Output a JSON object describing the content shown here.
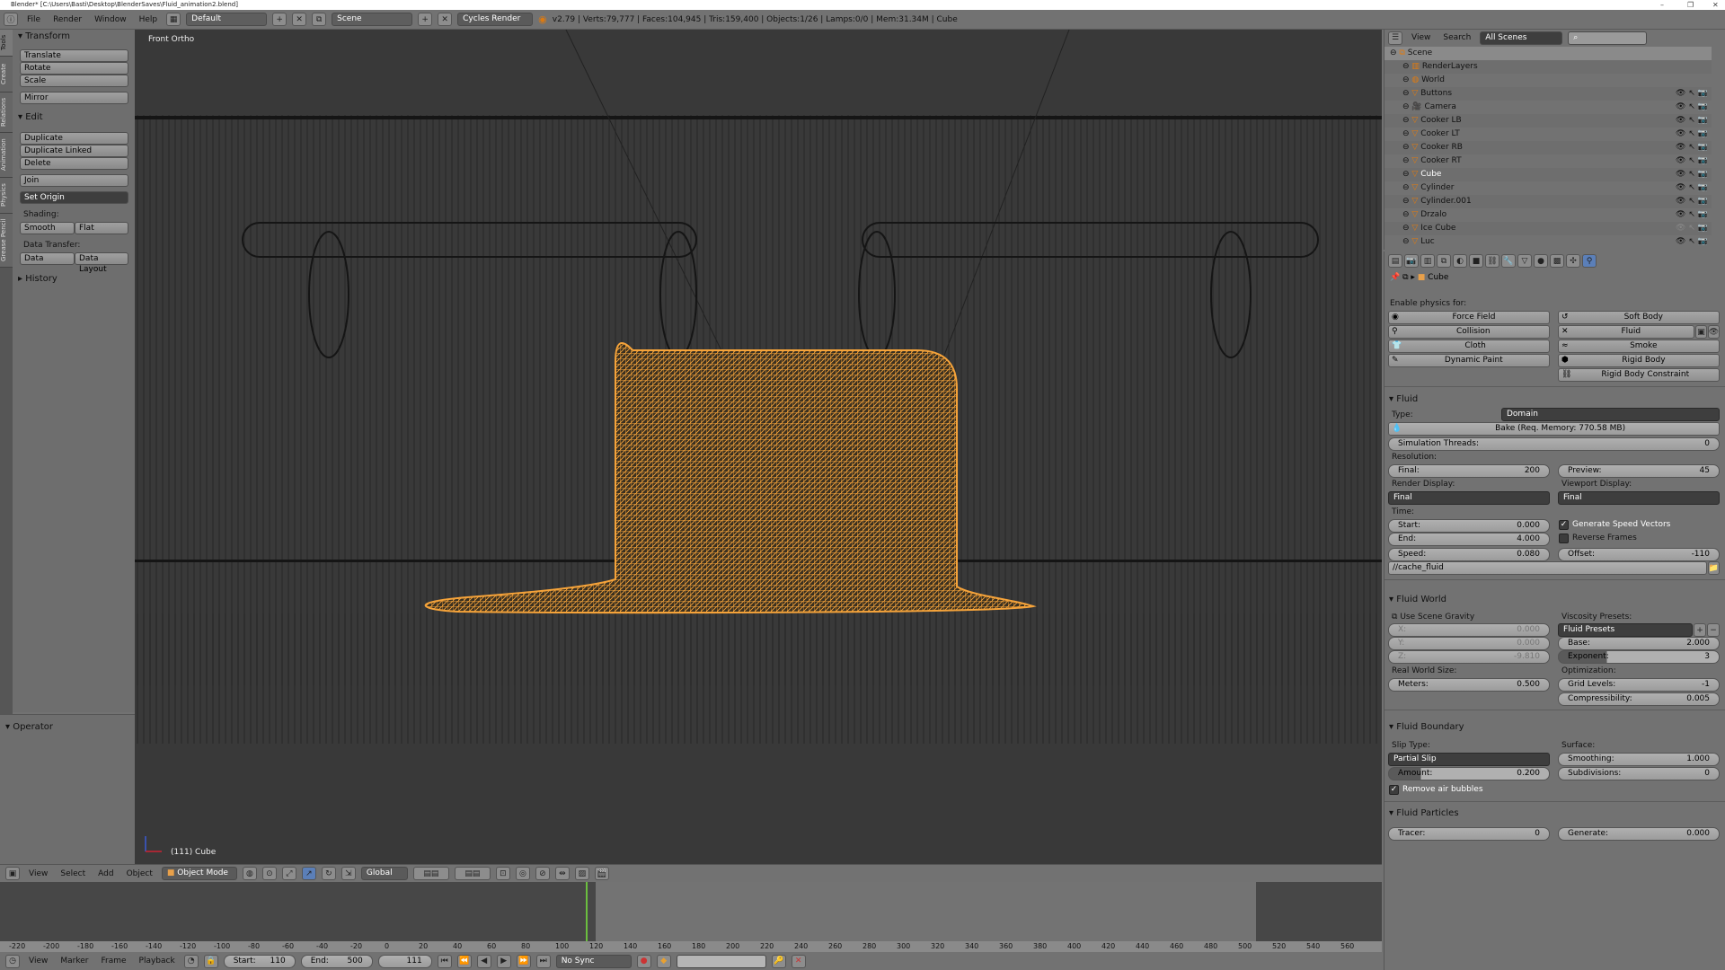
{
  "window": {
    "title": "Blender* [C:\\Users\\Basti\\Desktop\\BlenderSaves\\Fluid_animation2.blend]",
    "controls": [
      "–",
      "❐",
      "✕"
    ]
  },
  "topbar": {
    "menus": [
      "File",
      "Render",
      "Window",
      "Help"
    ],
    "layout": "Default",
    "scene": "Scene",
    "engine": "Cycles Render",
    "info": "v2.79 | Verts:79,777 | Faces:104,945 | Tris:159,400 | Objects:1/26 | Lamps:0/0 | Mem:31.34M | Cube"
  },
  "tool_tabs": [
    "Tools",
    "Create",
    "Relations",
    "Animation",
    "Physics",
    "Grease Pencil"
  ],
  "toolshelf": {
    "transform": {
      "title": "Transform",
      "buttons": [
        "Translate",
        "Rotate",
        "Scale"
      ],
      "mirror": "Mirror"
    },
    "edit": {
      "title": "Edit",
      "buttons": [
        "Duplicate",
        "Duplicate Linked",
        "Delete"
      ],
      "join": "Join",
      "set_origin": "Set Origin",
      "shading_label": "Shading:",
      "shading": [
        "Smooth",
        "Flat"
      ],
      "data_transfer_label": "Data Transfer:",
      "data_transfer": [
        "Data",
        "Data Layout"
      ]
    },
    "history": "History",
    "operator": "Operator"
  },
  "viewport": {
    "view_label": "Front Ortho",
    "object_label": "(111) Cube",
    "mesh_color": "#f5a33a"
  },
  "view_header": {
    "menus": [
      "View",
      "Select",
      "Add",
      "Object"
    ],
    "mode": "Object Mode",
    "orientation": "Global"
  },
  "timeline": {
    "ruler": [
      "-220",
      "-200",
      "-180",
      "-160",
      "-140",
      "-120",
      "-100",
      "-80",
      "-60",
      "-40",
      "-20",
      "0",
      "20",
      "40",
      "60",
      "80",
      "100",
      "120",
      "140",
      "160",
      "180",
      "200",
      "220",
      "240",
      "260",
      "280",
      "300",
      "320",
      "340",
      "360",
      "380",
      "400",
      "420",
      "440",
      "460",
      "480",
      "500",
      "520",
      "540",
      "560"
    ],
    "menus": [
      "View",
      "Marker",
      "Frame",
      "Playback"
    ],
    "start_label": "Start:",
    "start": "110",
    "end_label": "End:",
    "end": "500",
    "current": "111",
    "sync": "No Sync"
  },
  "outliner": {
    "menus": [
      "View",
      "Search"
    ],
    "filter": "All Scenes",
    "items": [
      {
        "name": "Scene",
        "level": 0
      },
      {
        "name": "RenderLayers",
        "level": 1
      },
      {
        "name": "World",
        "level": 1
      },
      {
        "name": "Buttons",
        "level": 1,
        "vis": true
      },
      {
        "name": "Camera",
        "level": 1,
        "vis": true
      },
      {
        "name": "Cooker LB",
        "level": 1,
        "vis": true
      },
      {
        "name": "Cooker LT",
        "level": 1,
        "vis": true
      },
      {
        "name": "Cooker RB",
        "level": 1,
        "vis": true
      },
      {
        "name": "Cooker RT",
        "level": 1,
        "vis": true
      },
      {
        "name": "Cube",
        "level": 1,
        "vis": true,
        "active": true
      },
      {
        "name": "Cylinder",
        "level": 1,
        "vis": true
      },
      {
        "name": "Cylinder.001",
        "level": 1,
        "vis": true
      },
      {
        "name": "Drzalo",
        "level": 1,
        "vis": true
      },
      {
        "name": "Ice Cube",
        "level": 1,
        "vis": false
      },
      {
        "name": "Luc",
        "level": 1,
        "vis": true
      }
    ]
  },
  "properties": {
    "context": "Cube",
    "enable_label": "Enable physics for:",
    "physics_left": [
      "Force Field",
      "Collision",
      "Cloth",
      "Dynamic Paint"
    ],
    "physics_right": [
      "Soft Body",
      "Fluid",
      "Smoke",
      "Rigid Body",
      "Rigid Body Constraint"
    ],
    "fluid": {
      "title": "Fluid",
      "type_label": "Type:",
      "type": "Domain",
      "bake": "Bake (Req. Memory: 770.58 MB)",
      "threads_label": "Simulation Threads:",
      "threads": "0",
      "resolution_label": "Resolution:",
      "final_label": "Final:",
      "final": "200",
      "preview_label": "Preview:",
      "preview": "45",
      "render_display_label": "Render Display:",
      "render_display": "Final",
      "viewport_display_label": "Viewport Display:",
      "viewport_display": "Final",
      "time_label": "Time:",
      "start_label": "Start:",
      "start": "0.000",
      "end_label": "End:",
      "end": "4.000",
      "speed_label": "Speed:",
      "speed": "0.080",
      "offset_label": "Offset:",
      "offset": "-110",
      "speed_vectors": "Generate Speed Vectors",
      "speed_vectors_checked": true,
      "reverse": "Reverse Frames",
      "reverse_checked": false,
      "cache_path": "//cache_fluid"
    },
    "fluid_world": {
      "title": "Fluid World",
      "use_gravity": "Use Scene Gravity",
      "x_label": "X:",
      "x": "0.000",
      "y_label": "Y:",
      "y": "0.000",
      "z_label": "Z:",
      "z": "-9.810",
      "real_world_label": "Real World Size:",
      "meters_label": "Meters:",
      "meters": "0.500",
      "viscosity_label": "Viscosity Presets:",
      "presets": "Fluid Presets",
      "base_label": "Base:",
      "base": "2.000",
      "exponent_label": "Exponent:",
      "exponent": "3",
      "optimization_label": "Optimization:",
      "grid_label": "Grid Levels:",
      "grid": "-1",
      "compress_label": "Compressibility:",
      "compress": "0.005"
    },
    "fluid_boundary": {
      "title": "Fluid Boundary",
      "slip_label": "Slip Type:",
      "slip": "Partial Slip",
      "amount_label": "Amount:",
      "amount": "0.200",
      "surface_label": "Surface:",
      "smoothing_label": "Smoothing:",
      "smoothing": "1.000",
      "subdiv_label": "Subdivisions:",
      "subdiv": "0",
      "remove_bubbles": "Remove air bubbles",
      "remove_bubbles_checked": true
    },
    "fluid_particles": {
      "title": "Fluid Particles",
      "tracer_label": "Tracer:",
      "tracer": "0",
      "generate_label": "Generate:",
      "generate": "0.000"
    }
  }
}
